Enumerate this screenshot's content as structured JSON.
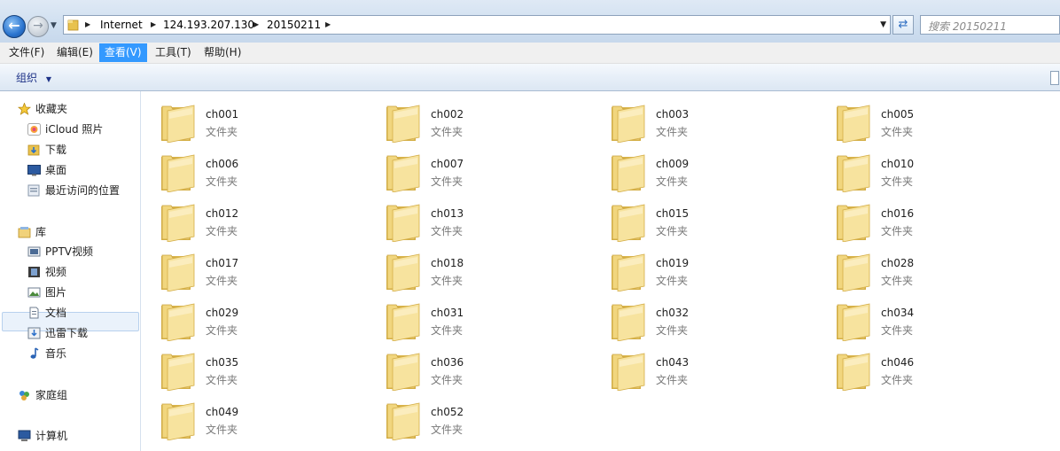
{
  "address": {
    "segments": [
      "Internet",
      "124.193.207.130",
      "20150211"
    ],
    "search_placeholder": "搜索 20150211"
  },
  "menu": {
    "items": [
      "文件(F)",
      "编辑(E)",
      "查看(V)",
      "工具(T)",
      "帮助(H)"
    ],
    "active_index": 2
  },
  "toolbar": {
    "organize_label": "组织"
  },
  "nav": {
    "favorites": {
      "label": "收藏夹",
      "items": [
        "iCloud 照片",
        "下载",
        "桌面",
        "最近访问的位置"
      ]
    },
    "libraries": {
      "label": "库",
      "items": [
        "PPTV视频",
        "视频",
        "图片",
        "文档",
        "迅雷下载",
        "音乐"
      ]
    },
    "homegroup": "家庭组",
    "computer": "计算机"
  },
  "folders": {
    "type_label": "文件夹",
    "names": [
      "ch001",
      "ch002",
      "ch003",
      "ch005",
      "ch006",
      "ch007",
      "ch009",
      "ch010",
      "ch012",
      "ch013",
      "ch015",
      "ch016",
      "ch017",
      "ch018",
      "ch019",
      "ch028",
      "ch029",
      "ch031",
      "ch032",
      "ch034",
      "ch035",
      "ch036",
      "ch043",
      "ch046",
      "ch049",
      "ch052"
    ]
  },
  "colors": {
    "menu_active": "#3399ff",
    "folder": "#f2d36b"
  }
}
